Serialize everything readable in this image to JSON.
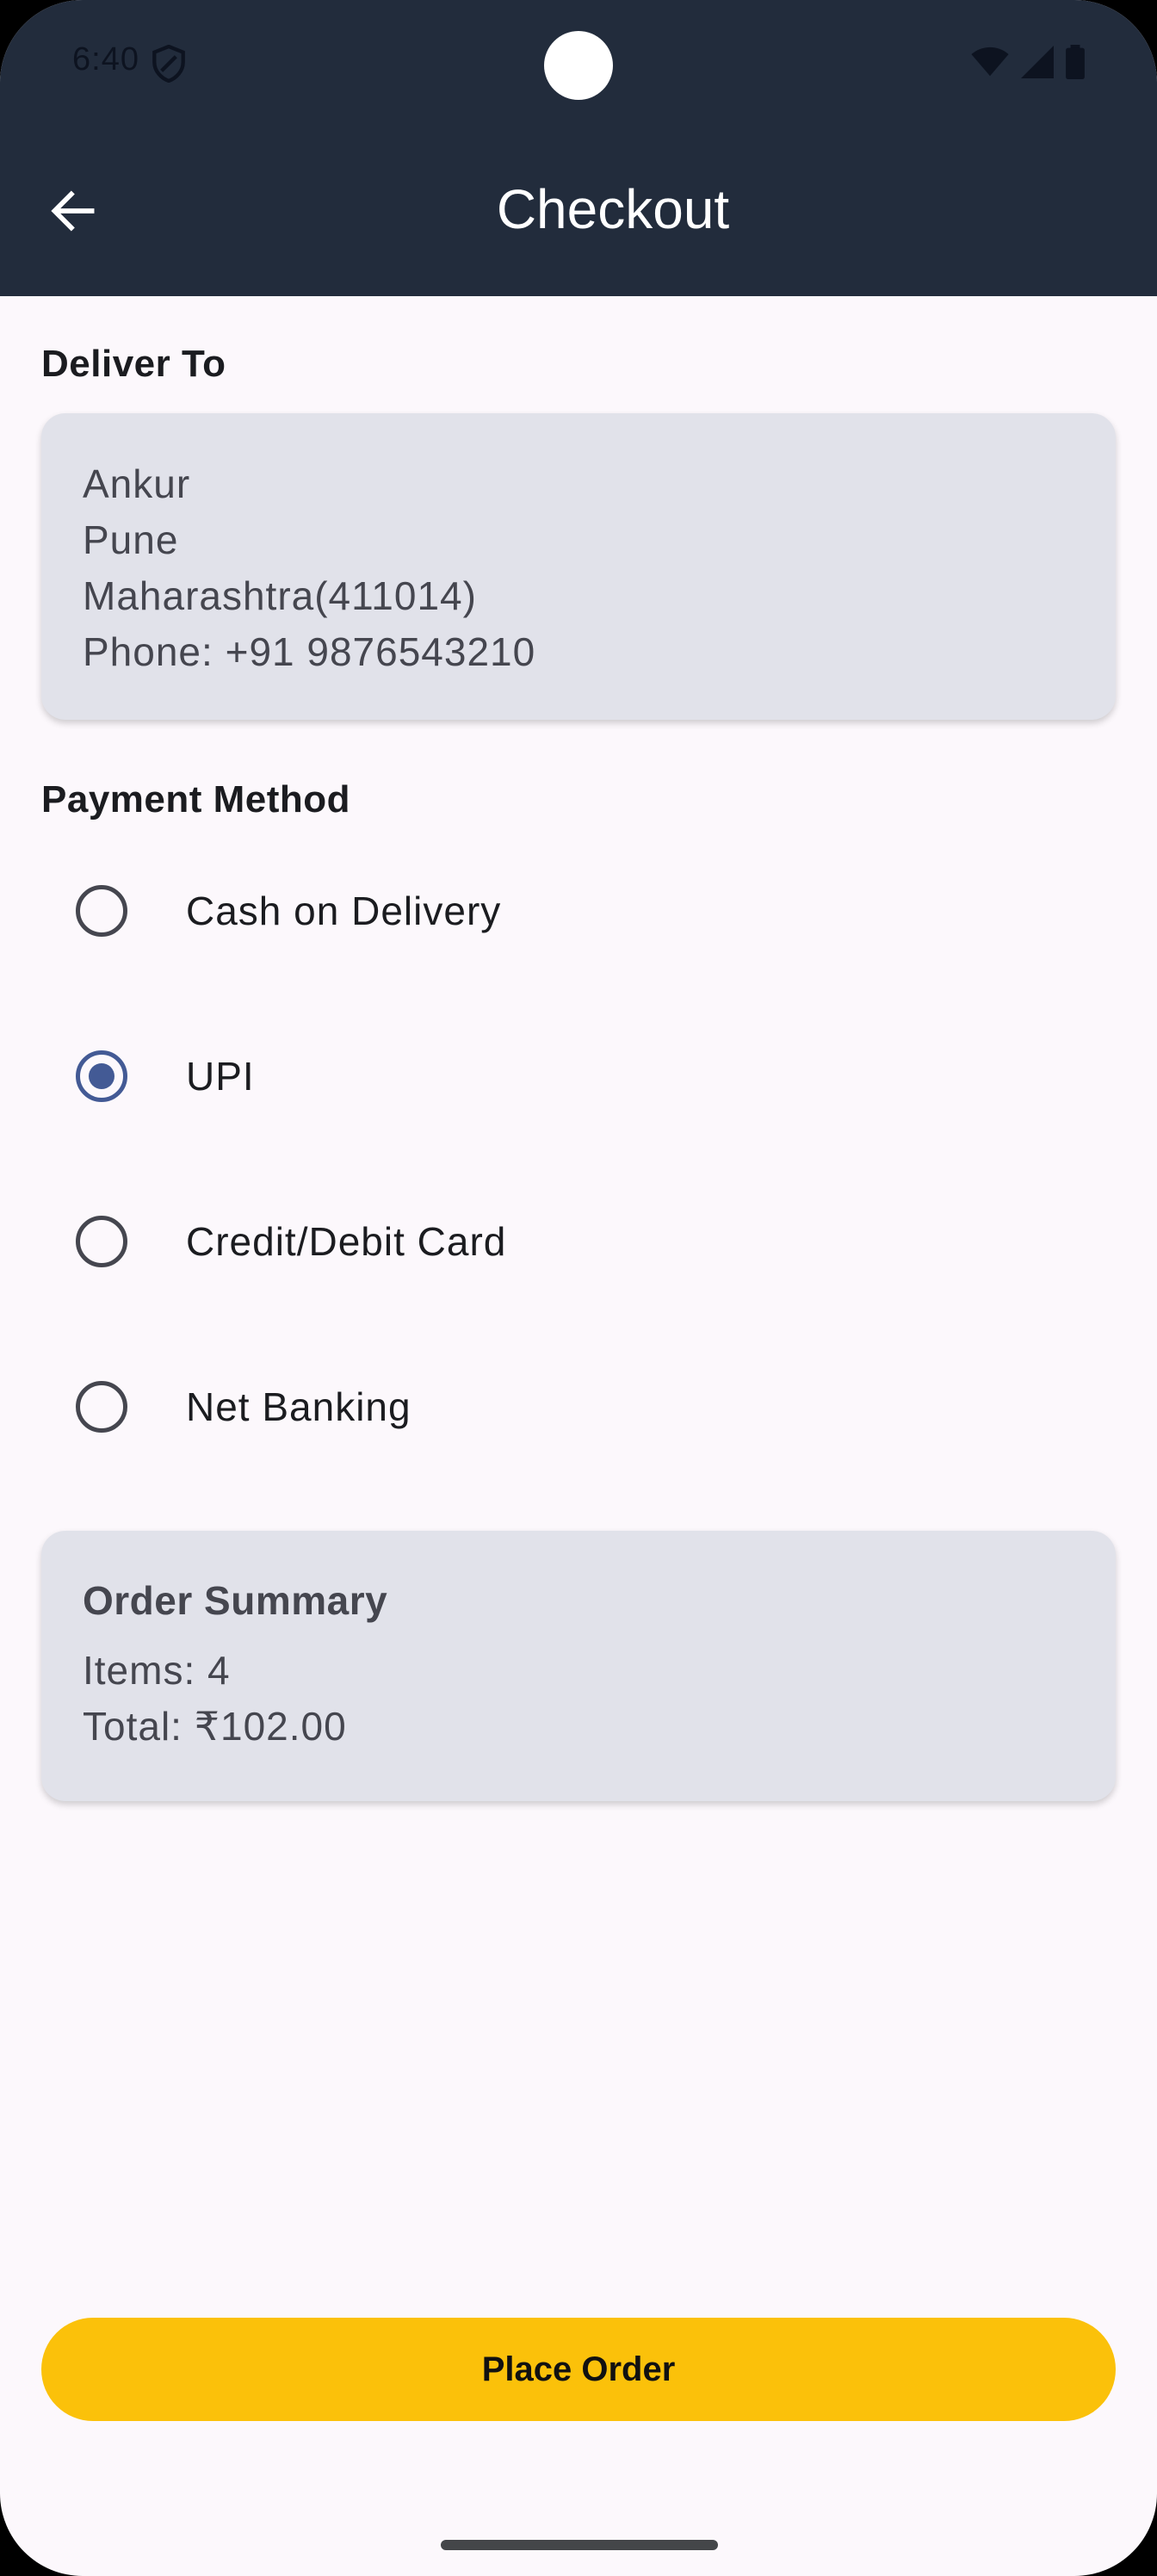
{
  "status_bar": {
    "time": "6:40"
  },
  "app_bar": {
    "title": "Checkout"
  },
  "deliver_to": {
    "heading": "Deliver To",
    "name": "Ankur",
    "city": "Pune",
    "state_pin": "Maharashtra(411014)",
    "phone": "Phone: +91 9876543210"
  },
  "payment": {
    "heading": "Payment Method",
    "options": [
      {
        "label": "Cash on Delivery",
        "selected": false
      },
      {
        "label": "UPI",
        "selected": true
      },
      {
        "label": "Credit/Debit Card",
        "selected": false
      },
      {
        "label": "Net Banking",
        "selected": false
      }
    ]
  },
  "summary": {
    "heading": "Order Summary",
    "items": "Items: 4",
    "total": "Total: ₹102.00"
  },
  "actions": {
    "place_order": "Place Order"
  },
  "colors": {
    "header_bg": "#222c3c",
    "page_bg": "#fcf8fc",
    "card_bg": "#e1e2ea",
    "accent": "#435a95",
    "button_bg": "#fbc10a"
  }
}
